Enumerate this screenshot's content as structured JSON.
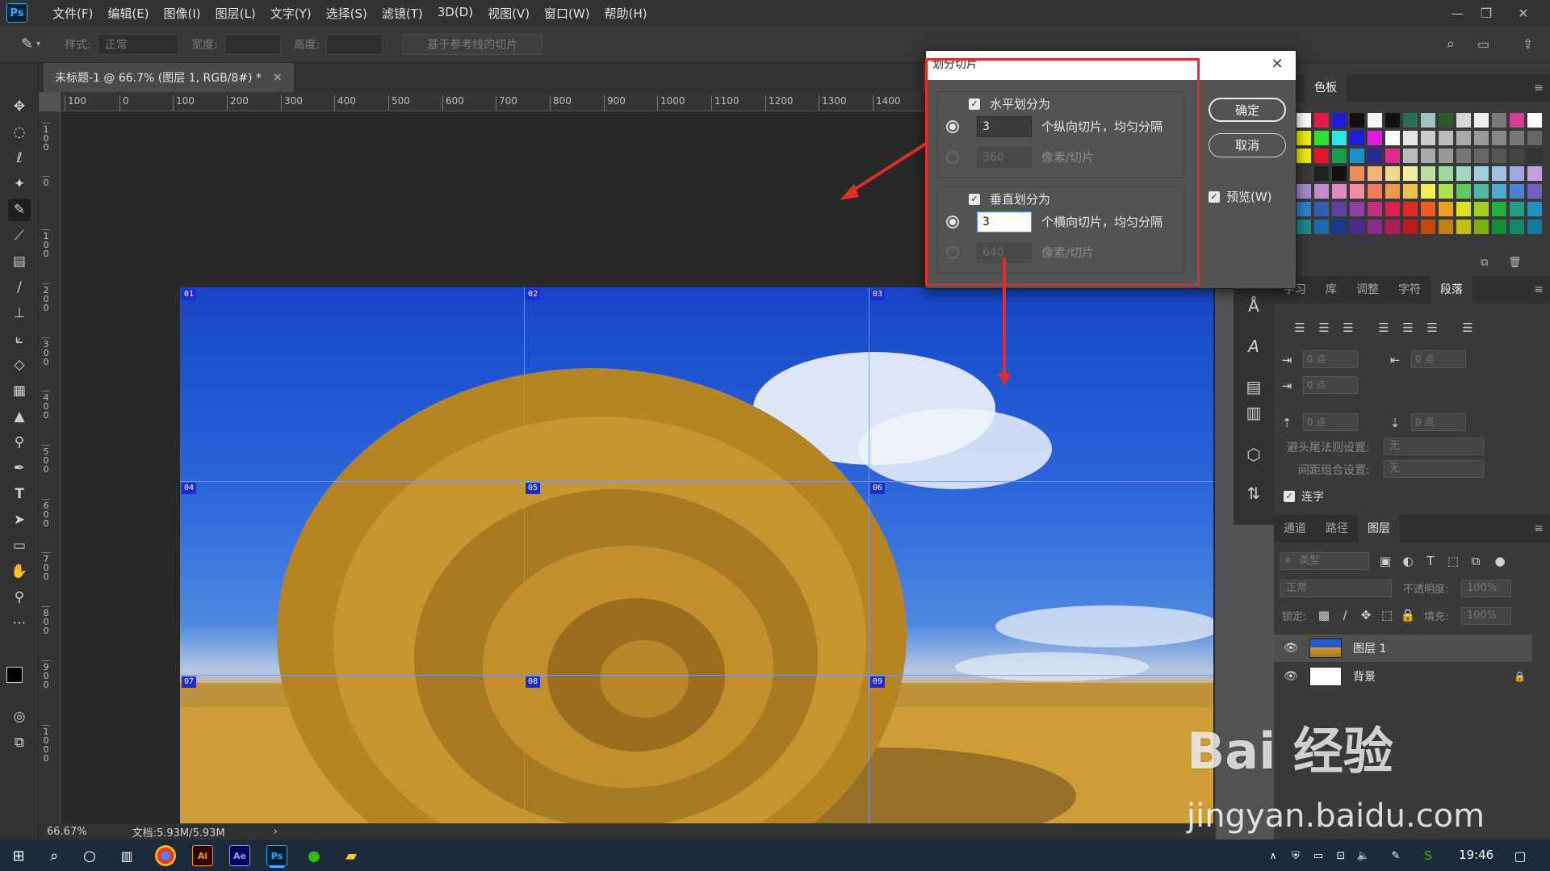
{
  "app": {
    "logo_text": "Ps",
    "menus": [
      "文件(F)",
      "编辑(E)",
      "图像(I)",
      "图层(L)",
      "文字(Y)",
      "选择(S)",
      "滤镜(T)",
      "3D(D)",
      "视图(V)",
      "窗口(W)",
      "帮助(H)"
    ],
    "window_controls": {
      "minimize": "—",
      "restore": "❐",
      "close": "✕"
    }
  },
  "options_bar": {
    "style_label": "样式:",
    "style_value": "正常",
    "width_label": "宽度:",
    "height_label": "高度:",
    "guides_button": "基于参考线的切片"
  },
  "document": {
    "tab_title": "未标题-1 @ 66.7% (图层 1, RGB/8#) *",
    "tab_close": "×",
    "ruler_h": [
      "100",
      "0",
      "100",
      "200",
      "300",
      "400",
      "500",
      "600",
      "700",
      "800",
      "900",
      "1000",
      "1100",
      "1200",
      "1300",
      "1400"
    ],
    "ruler_v": [
      "1 0 0",
      "0",
      "1 0 0",
      "2 0 0",
      "3 0 0",
      "4 0 0",
      "5 0 0",
      "6 0 0",
      "7 0 0",
      "8 0 0",
      "9 0 0",
      "1 0 0 0",
      "1 0 0 0"
    ],
    "slices": [
      "01",
      "02",
      "03",
      "04",
      "05",
      "06",
      "07",
      "08",
      "09"
    ]
  },
  "status": {
    "zoom": "66.67%",
    "doc_info": "文档:5.93M/5.93M",
    "arrow": "›"
  },
  "dialog": {
    "title": "划分切片",
    "close": "✕",
    "horizontal": {
      "label": "水平划分为",
      "checked": "✓",
      "count_value": "3",
      "count_text": "个纵向切片，均匀分隔",
      "pixel_value": "360",
      "pixel_text": "像素/切片"
    },
    "vertical": {
      "label": "垂直划分为",
      "checked": "✓",
      "count_value": "3",
      "count_text": "个横向切片，均匀分隔",
      "pixel_value": "640",
      "pixel_text": "像素/切片"
    },
    "ok": "确定",
    "cancel": "取消",
    "preview_label": "预览(W)",
    "preview_checked": "✓"
  },
  "swatches_panel": {
    "tabs": [
      "色",
      "色板"
    ],
    "colors": [
      "#ffffff",
      "#e8194a",
      "#1d1dd6",
      "#111111",
      "#f5f5f5",
      "#111111",
      "#2a6e5a",
      "#9ec3c0",
      "#2a5a2a",
      "#d6d6d6",
      "#eeeeee",
      "#7a7a7a",
      "#d63b96",
      "#ffffff",
      "#f0f000",
      "#2fe02f",
      "#2fe6e6",
      "#1d1de0",
      "#e01de0",
      "#ffffff",
      "#e6e6e6",
      "#cccccc",
      "#bbbbbb",
      "#aaaaaa",
      "#999999",
      "#888888",
      "#777777",
      "#666666",
      "#f0f000",
      "#e0162a",
      "#16a04a",
      "#1690d0",
      "#2a2a9a",
      "#e02a8a",
      "#bbbbbb",
      "#aaaaaa",
      "#999999",
      "#777777",
      "#666666",
      "#555555",
      "#444444",
      "#333333",
      "#3a3a3a",
      "#222222",
      "#111111",
      "#f08c5a",
      "#f3b47a",
      "#f5d890",
      "#f0f0a0",
      "#c0e0a0",
      "#a0d8a0",
      "#a0d8c0",
      "#a0d0e0",
      "#a0c0e8",
      "#a0a8e0",
      "#c0a0e0",
      "#a08cd0",
      "#c08cd0",
      "#e08cc0",
      "#f08ca0",
      "#f07860",
      "#f09a50",
      "#f0c050",
      "#f0f050",
      "#b0e050",
      "#60c860",
      "#50b8a0",
      "#50a8d0",
      "#5080d0",
      "#7060c0",
      "#3080c8",
      "#3060b0",
      "#6040a0",
      "#9040a0",
      "#c03080",
      "#e02050",
      "#e02a2a",
      "#f05a20",
      "#f0a020",
      "#e0e020",
      "#a0d020",
      "#20b040",
      "#20a080",
      "#2090c0",
      "#1a8a8a",
      "#1a6ab0",
      "#1a3a90",
      "#4a2a90",
      "#8a2a8a",
      "#b01a5a",
      "#c01a1a",
      "#c04a10",
      "#c08010",
      "#c0c010",
      "#80b010",
      "#10903a",
      "#108a6a",
      "#107aa0"
    ]
  },
  "paragraph_panel": {
    "tabs": [
      "字习",
      "库",
      "调整",
      "字符",
      "段落"
    ],
    "fields": [
      "0 点",
      "0 点",
      "0 点",
      "0 点",
      "0 点",
      "0 点"
    ],
    "kinsoku_label": "避头尾法则设置:",
    "kinsoku_value": "无",
    "mojikumi_label": "间距组合设置:",
    "mojikumi_value": "无",
    "hyphen_label": "连字",
    "hyphen_checked": "✓"
  },
  "layers_panel": {
    "tabs": [
      "通道",
      "路径",
      "图层"
    ],
    "filter_placeholder": "类型",
    "blend_mode": "正常",
    "opacity_label": "不透明度:",
    "opacity_value": "100%",
    "lock_label": "锁定:",
    "fill_label": "填充:",
    "fill_value": "100%",
    "layers": [
      {
        "name": "图层 1",
        "eye": "👁"
      },
      {
        "name": "背景",
        "eye": "👁",
        "lock": "🔒"
      }
    ]
  },
  "taskbar": {
    "clock": "19:46",
    "apps": [
      "Ai",
      "Ae",
      "Ps"
    ]
  },
  "watermark": {
    "brand": "Bai 经验",
    "url": "jingyan.baidu.com"
  }
}
